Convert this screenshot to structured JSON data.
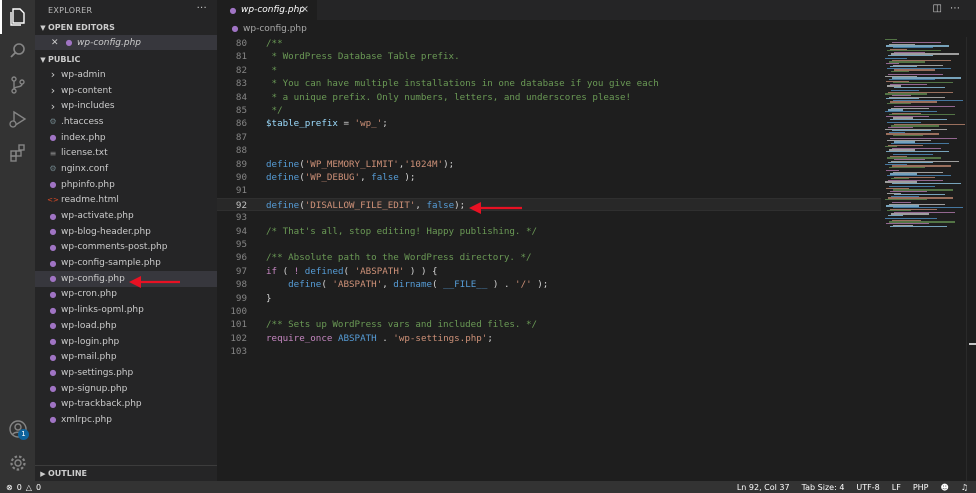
{
  "sidebar": {
    "title": "EXPLORER",
    "more": "···",
    "open_editors_label": "OPEN EDITORS",
    "open_editor_file": "wp-config.php",
    "folder_label": "PUBLIC",
    "outline_label": "OUTLINE",
    "items": [
      {
        "label": "wp-admin",
        "kind": "folder",
        "icon": "chevron-right-icon"
      },
      {
        "label": "wp-content",
        "kind": "folder",
        "icon": "chevron-right-icon"
      },
      {
        "label": "wp-includes",
        "kind": "folder",
        "icon": "chevron-right-icon"
      },
      {
        "label": ".htaccess",
        "kind": "file",
        "icon": "gear-file-icon",
        "color": "#6d8086"
      },
      {
        "label": "index.php",
        "kind": "file",
        "icon": "php-icon",
        "color": "#a074c4"
      },
      {
        "label": "license.txt",
        "kind": "file",
        "icon": "text-file-icon",
        "color": "#8c8c8c"
      },
      {
        "label": "nginx.conf",
        "kind": "file",
        "icon": "gear-file-icon",
        "color": "#6d8086"
      },
      {
        "label": "phpinfo.php",
        "kind": "file",
        "icon": "php-icon",
        "color": "#a074c4"
      },
      {
        "label": "readme.html",
        "kind": "file",
        "icon": "html-icon",
        "color": "#e44d26"
      },
      {
        "label": "wp-activate.php",
        "kind": "file",
        "icon": "php-icon",
        "color": "#a074c4"
      },
      {
        "label": "wp-blog-header.php",
        "kind": "file",
        "icon": "php-icon",
        "color": "#a074c4"
      },
      {
        "label": "wp-comments-post.php",
        "kind": "file",
        "icon": "php-icon",
        "color": "#a074c4"
      },
      {
        "label": "wp-config-sample.php",
        "kind": "file",
        "icon": "php-icon",
        "color": "#a074c4"
      },
      {
        "label": "wp-config.php",
        "kind": "file",
        "icon": "php-icon",
        "color": "#a074c4",
        "selected": true
      },
      {
        "label": "wp-cron.php",
        "kind": "file",
        "icon": "php-icon",
        "color": "#a074c4"
      },
      {
        "label": "wp-links-opml.php",
        "kind": "file",
        "icon": "php-icon",
        "color": "#a074c4"
      },
      {
        "label": "wp-load.php",
        "kind": "file",
        "icon": "php-icon",
        "color": "#a074c4"
      },
      {
        "label": "wp-login.php",
        "kind": "file",
        "icon": "php-icon",
        "color": "#a074c4"
      },
      {
        "label": "wp-mail.php",
        "kind": "file",
        "icon": "php-icon",
        "color": "#a074c4"
      },
      {
        "label": "wp-settings.php",
        "kind": "file",
        "icon": "php-icon",
        "color": "#a074c4"
      },
      {
        "label": "wp-signup.php",
        "kind": "file",
        "icon": "php-icon",
        "color": "#a074c4"
      },
      {
        "label": "wp-trackback.php",
        "kind": "file",
        "icon": "php-icon",
        "color": "#a074c4"
      },
      {
        "label": "xmlrpc.php",
        "kind": "file",
        "icon": "php-icon",
        "color": "#a074c4"
      }
    ]
  },
  "activity": {
    "icons": [
      "files-icon",
      "search-icon",
      "source-control-icon",
      "run-debug-icon",
      "extensions-icon"
    ],
    "account_badge": "1",
    "bottom_icons": [
      "account-icon",
      "manage-gear-icon"
    ]
  },
  "editor": {
    "tab_label": "wp-config.php",
    "tab_close": "×",
    "breadcrumb": "wp-config.php",
    "current_line": "92",
    "lines": [
      {
        "n": "80",
        "tokens": [
          {
            "t": "/**",
            "c": "c"
          }
        ]
      },
      {
        "n": "81",
        "tokens": [
          {
            "t": " * WordPress Database Table prefix.",
            "c": "c"
          }
        ]
      },
      {
        "n": "82",
        "tokens": [
          {
            "t": " *",
            "c": "c"
          }
        ]
      },
      {
        "n": "83",
        "tokens": [
          {
            "t": " * You can have multiple installations in one database if you give each",
            "c": "c"
          }
        ]
      },
      {
        "n": "84",
        "tokens": [
          {
            "t": " * a unique prefix. Only numbers, letters, and underscores please!",
            "c": "c"
          }
        ]
      },
      {
        "n": "85",
        "tokens": [
          {
            "t": " */",
            "c": "c"
          }
        ]
      },
      {
        "n": "86",
        "tokens": [
          {
            "t": "$table_prefix",
            "c": "v"
          },
          {
            "t": " = ",
            "c": "p"
          },
          {
            "t": "'wp_'",
            "c": "s"
          },
          {
            "t": ";",
            "c": "p"
          }
        ]
      },
      {
        "n": "87",
        "tokens": []
      },
      {
        "n": "88",
        "tokens": []
      },
      {
        "n": "89",
        "tokens": [
          {
            "t": "define",
            "c": "k"
          },
          {
            "t": "(",
            "c": "p"
          },
          {
            "t": "'WP_MEMORY_LIMIT'",
            "c": "s"
          },
          {
            "t": ",",
            "c": "p"
          },
          {
            "t": "'1024M'",
            "c": "s"
          },
          {
            "t": ");",
            "c": "p"
          }
        ]
      },
      {
        "n": "90",
        "tokens": [
          {
            "t": "define",
            "c": "k"
          },
          {
            "t": "(",
            "c": "p"
          },
          {
            "t": "'WP_DEBUG'",
            "c": "s"
          },
          {
            "t": ", ",
            "c": "p"
          },
          {
            "t": "false",
            "c": "kc"
          },
          {
            "t": " );",
            "c": "p"
          }
        ]
      },
      {
        "n": "91",
        "tokens": []
      },
      {
        "n": "92",
        "tokens": [
          {
            "t": "define",
            "c": "k"
          },
          {
            "t": "(",
            "c": "p"
          },
          {
            "t": "'DISALLOW_FILE_EDIT'",
            "c": "s"
          },
          {
            "t": ", ",
            "c": "p"
          },
          {
            "t": "false",
            "c": "kc"
          },
          {
            "t": ");",
            "c": "p"
          }
        ]
      },
      {
        "n": "93",
        "tokens": []
      },
      {
        "n": "94",
        "tokens": [
          {
            "t": "/* That's all, stop editing! Happy publishing. */",
            "c": "c"
          }
        ]
      },
      {
        "n": "95",
        "tokens": []
      },
      {
        "n": "96",
        "tokens": [
          {
            "t": "/** Absolute path to the WordPress directory. */",
            "c": "c"
          }
        ]
      },
      {
        "n": "97",
        "tokens": [
          {
            "t": "if",
            "c": "f"
          },
          {
            "t": " ( ",
            "c": "p"
          },
          {
            "t": "!",
            "c": "f"
          },
          {
            "t": " ",
            "c": "p"
          },
          {
            "t": "defined",
            "c": "k"
          },
          {
            "t": "( ",
            "c": "p"
          },
          {
            "t": "'ABSPATH'",
            "c": "s"
          },
          {
            "t": " ) ) {",
            "c": "p"
          }
        ]
      },
      {
        "n": "98",
        "tokens": [
          {
            "t": "    ",
            "c": "p"
          },
          {
            "t": "define",
            "c": "k"
          },
          {
            "t": "( ",
            "c": "p"
          },
          {
            "t": "'ABSPATH'",
            "c": "s"
          },
          {
            "t": ", ",
            "c": "p"
          },
          {
            "t": "dirname",
            "c": "k"
          },
          {
            "t": "( ",
            "c": "p"
          },
          {
            "t": "__FILE__",
            "c": "k"
          },
          {
            "t": " ) . ",
            "c": "p"
          },
          {
            "t": "'/'",
            "c": "s"
          },
          {
            "t": " );",
            "c": "p"
          }
        ]
      },
      {
        "n": "99",
        "tokens": [
          {
            "t": "}",
            "c": "p"
          }
        ]
      },
      {
        "n": "100",
        "tokens": []
      },
      {
        "n": "101",
        "tokens": [
          {
            "t": "/** Sets up WordPress vars and included files. */",
            "c": "c"
          }
        ]
      },
      {
        "n": "102",
        "tokens": [
          {
            "t": "require_once",
            "c": "req"
          },
          {
            "t": " ",
            "c": "p"
          },
          {
            "t": "ABSPATH",
            "c": "k"
          },
          {
            "t": " . ",
            "c": "p"
          },
          {
            "t": "'wp-settings.php'",
            "c": "s"
          },
          {
            "t": ";",
            "c": "p"
          }
        ]
      },
      {
        "n": "103",
        "tokens": []
      }
    ]
  },
  "status": {
    "errors": "0",
    "warnings": "0",
    "position": "Ln 92, Col 37",
    "tab_size": "Tab Size: 4",
    "encoding": "UTF-8",
    "eol": "LF",
    "language": "PHP"
  },
  "colors": {
    "activity_bg": "#333333",
    "sidebar_bg": "#252526",
    "editor_bg": "#1e1e1e",
    "arrow": "#e81123",
    "php_icon": "#a074c4"
  }
}
